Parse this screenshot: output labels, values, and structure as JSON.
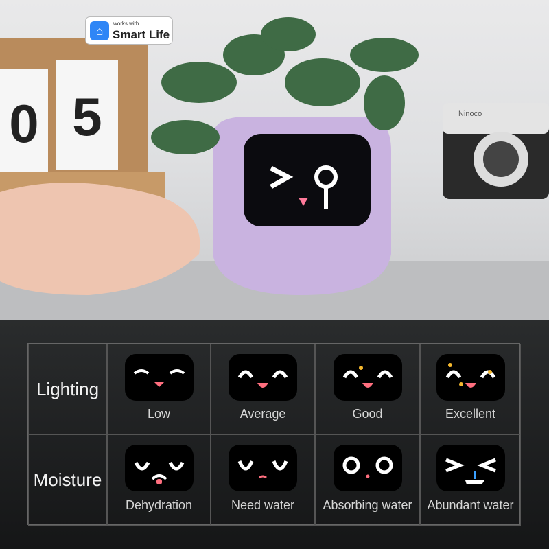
{
  "badge": {
    "small": "works with",
    "brand": "Smart Life",
    "icon": "home-icon",
    "color": "#2f86f6"
  },
  "calendar": {
    "digits": [
      "0",
      "5"
    ]
  },
  "camera": {
    "brand": "Ninoco"
  },
  "table": {
    "rows": [
      {
        "label": "Lighting",
        "items": [
          "Low",
          "Average",
          "Good",
          "Excellent"
        ]
      },
      {
        "label": "Moisture",
        "items": [
          "Dehydration",
          "Need water",
          "Absorbing water",
          "Abundant water"
        ]
      }
    ]
  }
}
